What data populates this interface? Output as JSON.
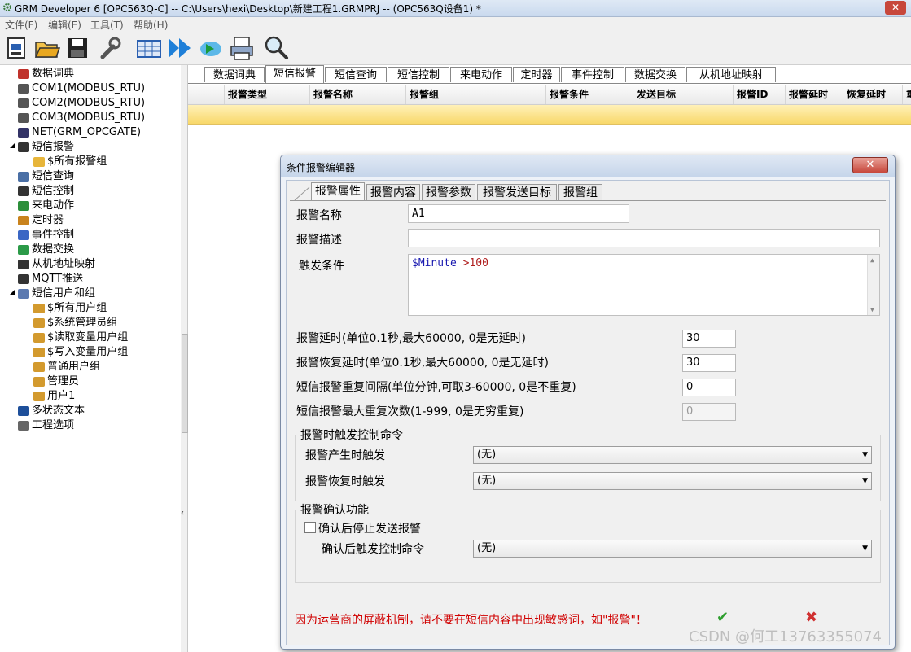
{
  "window": {
    "title": "GRM Developer 6 [OPC563Q-C]  -- C:\\Users\\hexi\\Desktop\\新建工程1.GRMPRJ -- (OPC563Q设备1) *",
    "close": "✕"
  },
  "menu": [
    "文件(F)",
    "编辑(E)",
    "工具(T)",
    "帮助(H)"
  ],
  "toolbar": [
    "new-project-icon",
    "open-folder-icon",
    "save-icon",
    "settings-wrench-icon",
    "grid-config-icon",
    "forward-icon",
    "download-cloud-icon",
    "print-icon",
    "search-icon"
  ],
  "tree": [
    {
      "label": "数据词典",
      "icon": "dictionary-icon",
      "indent": 1
    },
    {
      "label": "COM1(MODBUS_RTU)",
      "icon": "serial-port-icon",
      "indent": 1
    },
    {
      "label": "COM2(MODBUS_RTU)",
      "icon": "serial-port-icon",
      "indent": 1
    },
    {
      "label": "COM3(MODBUS_RTU)",
      "icon": "serial-port-icon",
      "indent": 1
    },
    {
      "label": "NET(GRM_OPCGATE)",
      "icon": "network-icon",
      "indent": 1
    },
    {
      "label": "短信报警",
      "icon": "bell-icon",
      "indent": 1,
      "expander": "◢"
    },
    {
      "label": "$所有报警组",
      "icon": "folder-lock-icon",
      "indent": 2
    },
    {
      "label": "短信查询",
      "icon": "query-icon",
      "indent": 1
    },
    {
      "label": "短信控制",
      "icon": "cmd-icon",
      "indent": 1
    },
    {
      "label": "来电动作",
      "icon": "phone-icon",
      "indent": 1
    },
    {
      "label": "定时器",
      "icon": "timer-icon",
      "indent": 1
    },
    {
      "label": "事件控制",
      "icon": "event-icon",
      "indent": 1
    },
    {
      "label": "数据交换",
      "icon": "exchange-icon",
      "indent": 1
    },
    {
      "label": "从机地址映射",
      "icon": "binary-icon",
      "indent": 1
    },
    {
      "label": "MQTT推送",
      "icon": "mqtt-icon",
      "indent": 1
    },
    {
      "label": "短信用户和组",
      "icon": "users-group-icon",
      "indent": 1,
      "expander": "◢"
    },
    {
      "label": "$所有用户组",
      "icon": "user-group-icon",
      "indent": 2
    },
    {
      "label": "$系统管理员组",
      "icon": "user-group-icon",
      "indent": 2
    },
    {
      "label": "$读取变量用户组",
      "icon": "user-group-icon",
      "indent": 2
    },
    {
      "label": "$写入变量用户组",
      "icon": "user-group-icon",
      "indent": 2
    },
    {
      "label": "普通用户组",
      "icon": "user-group-icon",
      "indent": 2
    },
    {
      "label": "管理员",
      "icon": "user-icon",
      "indent": 2
    },
    {
      "label": "用户1",
      "icon": "user-icon",
      "indent": 2
    },
    {
      "label": "多状态文本",
      "icon": "text-icon",
      "indent": 1
    },
    {
      "label": "工程选项",
      "icon": "wrench-icon",
      "indent": 1
    }
  ],
  "main_tabs": [
    "数据词典",
    "短信报警",
    "短信查询",
    "短信控制",
    "来电动作",
    "定时器",
    "事件控制",
    "数据交换",
    "从机地址映射"
  ],
  "main_active_tab": 1,
  "grid_columns": [
    "报警类型",
    "报警名称",
    "报警组",
    "报警条件",
    "发送目标",
    "报警ID",
    "报警延时",
    "恢复延时",
    "重"
  ],
  "dialog": {
    "title": "条件报警编辑器",
    "close": "✕",
    "tabs": [
      "报警属性",
      "报警内容",
      "报警参数",
      "报警发送目标",
      "报警组"
    ],
    "active_tab": 0,
    "name_label": "报警名称",
    "name_value": "A1",
    "desc_label": "报警描述",
    "desc_value": "",
    "trigger_label": "触发条件",
    "trigger_var": "$Minute",
    "trigger_op": " >100",
    "delay_label": "报警延时(单位0.1秒,最大60000, 0是无延时)",
    "delay_value": "30",
    "recover_label": "报警恢复延时(单位0.1秒,最大60000, 0是无延时)",
    "recover_value": "30",
    "repeat_label": "短信报警重复间隔(单位分钟,可取3-60000, 0是不重复)",
    "repeat_value": "0",
    "max_repeat_label": "短信报警最大重复次数(1-999, 0是无穷重复)",
    "max_repeat_value": "0",
    "group1_title": "报警时触发控制命令",
    "on_alarm_label": "报警产生时触发",
    "on_alarm_value": "(无)",
    "on_recover_label": "报警恢复时触发",
    "on_recover_value": "(无)",
    "group2_title": "报警确认功能",
    "confirm_stop_label": "确认后停止发送报警",
    "confirm_stop_checked": false,
    "confirm_cmd_label": "确认后触发控制命令",
    "confirm_cmd_value": "(无)",
    "warning": "因为运营商的屏蔽机制，请不要在短信内容中出现敏感词，如\"报警\"！",
    "ok": "✔",
    "cancel": "✖"
  },
  "watermark": "CSDN @何工13763355074",
  "colors": {
    "accent": "#2a5fb0",
    "warning": "#d00000",
    "selected_row": "#f8d86a",
    "ok": "#2e9e2e",
    "cancel": "#d03030"
  }
}
